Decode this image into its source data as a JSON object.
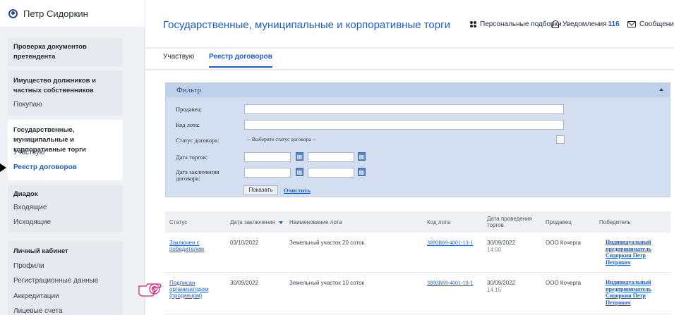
{
  "user": {
    "name": "Петр Сидоркин"
  },
  "sidebar": {
    "groups": [
      {
        "title": "Проверка документов претендента",
        "items": []
      },
      {
        "title": "Имущество должников и частных собственников",
        "items": [
          "Покупаю"
        ]
      },
      {
        "title": "Государственные, муниципальные и корпоративные торги",
        "items": [
          "Участвую",
          "Реестр договоров"
        ],
        "active_item": "Реестр договоров"
      },
      {
        "title": "Диадок",
        "items": [
          "Входящие",
          "Исходящие"
        ]
      },
      {
        "title": "Личный кабинет",
        "items": [
          "Профили",
          "Регистрационные данные",
          "Аккредитации",
          "Лицевые счета"
        ]
      }
    ]
  },
  "header": {
    "title": "Государственные, муниципальные и корпоративные торги",
    "personal": "Персональные подборки",
    "notifications_label": "Уведомления",
    "notifications_count": "116",
    "messages": "Сообщения"
  },
  "tabs": [
    {
      "label": "Участвую",
      "active": false
    },
    {
      "label": "Реестр договоров",
      "active": true
    }
  ],
  "filter": {
    "title": "Фильтр",
    "seller_label": "Продавец:",
    "lot_code_label": "Код лота:",
    "status_label": "Статус договора:",
    "status_placeholder": "-- Выберите статус договора --",
    "auction_date_label": "Дата торгов:",
    "contract_date_label": "Дата заключения договора:",
    "show_button": "Показать",
    "clear_link": "Очистить"
  },
  "table": {
    "columns": [
      "Статус",
      "Дата заключения",
      "Наименование лота",
      "Код лота",
      "Дата проведения торгов",
      "Продавец",
      "Победитель"
    ],
    "rows": [
      {
        "status": "Заключен с победителем",
        "date": "03/10/2022",
        "lot_name": "Земельный участок 20 соток",
        "lot_code": "3890B69-4001-13-1",
        "auction_date": "30/09/2022",
        "auction_time": "14:00",
        "seller": "ООО Кочерга",
        "winner": "Индивидуальный предприниматель Сидоркин Петр Петрович"
      },
      {
        "status": "Подписан организатором (продавцом)",
        "date": "30/09/2022",
        "lot_name": "Земельный участок 10 соток",
        "lot_code": "3890B69-4001-10-1",
        "auction_date": "30/09/2022",
        "auction_time": "14:15",
        "seller": "ООО Кочерга",
        "winner": "Индивидуальный предприниматель Сидоркин Петр Петрович"
      }
    ]
  },
  "colors": {
    "accent": "#1c5cc7",
    "filter_bg": "#d3dff0",
    "sidebar_bg": "#eef0f3"
  }
}
